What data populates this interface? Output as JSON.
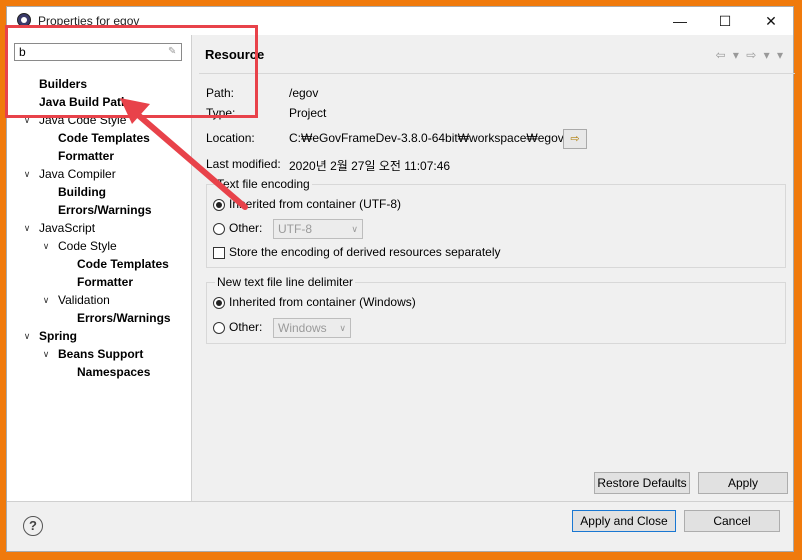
{
  "window": {
    "title": "Properties for egov",
    "minimize": "—",
    "maximize": "☐",
    "close": "✕"
  },
  "filter": {
    "value": "b"
  },
  "tree": [
    {
      "label": "Builders",
      "bold": true
    },
    {
      "label": "Java Build Path",
      "bold": true
    },
    {
      "label": "Java Code Style",
      "bold": false
    },
    {
      "label": "Code Templates",
      "bold": true
    },
    {
      "label": "Formatter",
      "bold": true
    },
    {
      "label": "Java Compiler",
      "bold": false
    },
    {
      "label": "Building",
      "bold": true
    },
    {
      "label": "Errors/Warnings",
      "bold": true
    },
    {
      "label": "JavaScript",
      "bold": false
    },
    {
      "label": "Code Style",
      "bold": false
    },
    {
      "label": "Code Templates",
      "bold": true
    },
    {
      "label": "Formatter",
      "bold": true
    },
    {
      "label": "Validation",
      "bold": false
    },
    {
      "label": "Errors/Warnings",
      "bold": true
    },
    {
      "label": "Spring",
      "bold": true
    },
    {
      "label": "Beans Support",
      "bold": true
    },
    {
      "label": "Namespaces",
      "bold": true
    }
  ],
  "page": {
    "title": "Resource",
    "path_label": "Path:",
    "path_value": "/egov",
    "type_label": "Type:",
    "type_value": "Project",
    "location_label": "Location:",
    "location_value": "C:₩eGovFrameDev-3.8.0-64bit₩workspace₩egov",
    "modified_label": "Last modified:",
    "modified_value": "2020년 2월 27일 오전 11:07:46"
  },
  "encoding": {
    "group_label": "Text file encoding",
    "inherited_label": "Inherited from container (UTF-8)",
    "other_label": "Other:",
    "other_value": "UTF-8",
    "store_label": "Store the encoding of derived resources separately"
  },
  "delimiter": {
    "group_label": "New text file line delimiter",
    "inherited_label": "Inherited from container (Windows)",
    "other_label": "Other:",
    "other_value": "Windows"
  },
  "buttons": {
    "restore_defaults": "Restore Defaults",
    "apply": "Apply",
    "apply_and_close": "Apply and Close",
    "cancel": "Cancel",
    "help": "?"
  },
  "icons": {
    "nav": "⇦ ▾ ⇨ ▾ ▾",
    "location": "⇨"
  },
  "colors": {
    "background_frame": "#f07a0c",
    "annotation": "#e8424a"
  }
}
